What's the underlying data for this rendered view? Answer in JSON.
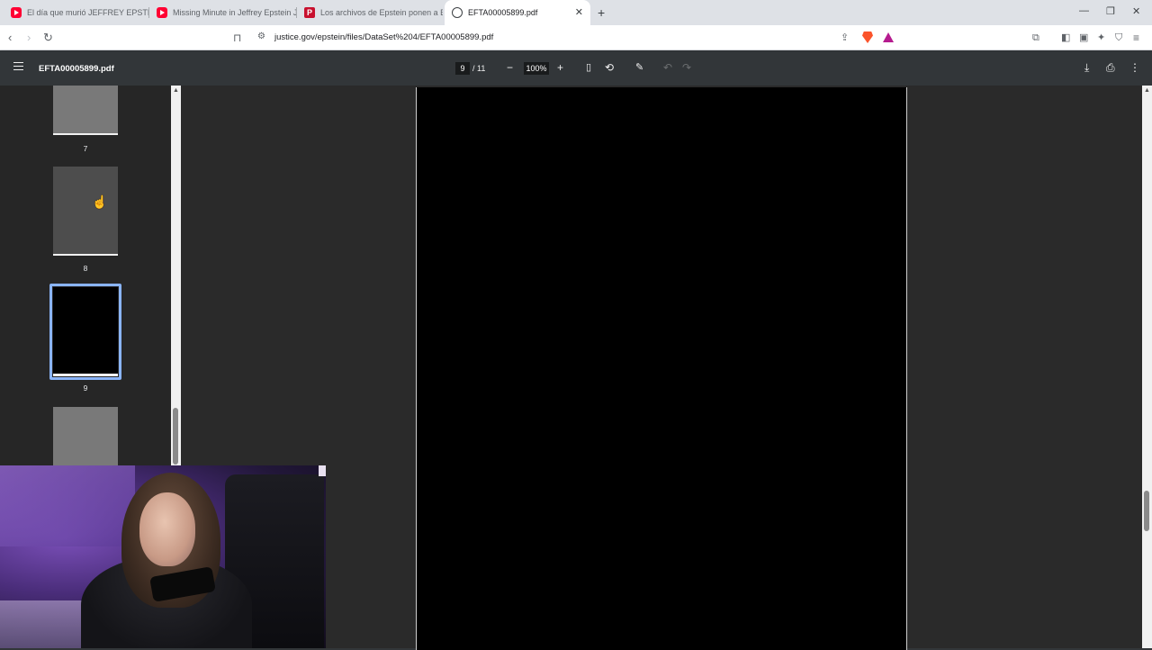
{
  "tabs": [
    {
      "title": "El día que murió JEFFREY EPSTEIN - Y",
      "icon": "youtube-icon"
    },
    {
      "title": "Missing Minute in Jeffrey Epstein Jail",
      "icon": "youtube-icon"
    },
    {
      "title": "Los archivos de Epstein ponen a Bill C",
      "icon": "news-icon"
    },
    {
      "title": "EFTA00005899.pdf",
      "icon": "globe-icon",
      "active": true
    }
  ],
  "address": {
    "url": "justice.gov/epstein/files/DataSet%204/EFTA00005899.pdf"
  },
  "pdf": {
    "filename": "EFTA00005899.pdf",
    "current_page": "9",
    "total_pages": "/ 11",
    "zoom": "100%"
  },
  "thumbnails": [
    {
      "label": "7",
      "color": "#797979"
    },
    {
      "label": "8",
      "color": "#4d4d4d"
    },
    {
      "label": "9",
      "color": "#000000",
      "selected": true
    },
    {
      "label": "",
      "color": "#797979"
    }
  ],
  "colors": {
    "pdf_toolbar": "#323639",
    "sidebar": "#262626",
    "selection": "#8ab4f8"
  }
}
